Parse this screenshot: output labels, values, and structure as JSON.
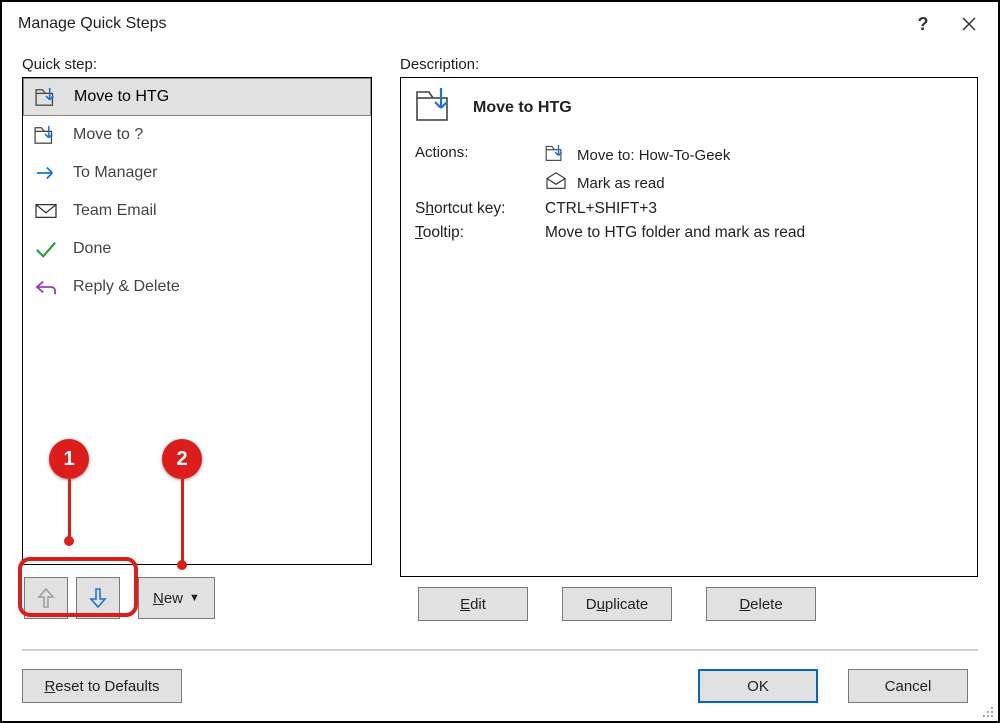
{
  "titlebar": {
    "title": "Manage Quick Steps"
  },
  "left_label": "Quick step:",
  "right_label": "Description:",
  "quick_steps": [
    {
      "label": "Move to HTG",
      "icon": "move-folder"
    },
    {
      "label": "Move to ?",
      "icon": "move-folder"
    },
    {
      "label": "To Manager",
      "icon": "arrow-right"
    },
    {
      "label": "Team Email",
      "icon": "envelope"
    },
    {
      "label": "Done",
      "icon": "check"
    },
    {
      "label": "Reply & Delete",
      "icon": "reply"
    }
  ],
  "selected_index": 0,
  "detail": {
    "name": "Move to HTG",
    "actions_label": "Actions:",
    "actions": [
      {
        "icon": "move-folder",
        "text": "Move to: How-To-Geek"
      },
      {
        "icon": "envelope-open",
        "text": "Mark as read"
      }
    ],
    "shortcut_label_pre": "S",
    "shortcut_label_u": "h",
    "shortcut_label_post": "ortcut key:",
    "shortcut_value": "CTRL+SHIFT+3",
    "tooltip_label_u": "T",
    "tooltip_label_post": "ooltip:",
    "tooltip_value": "Move to HTG folder and mark as read"
  },
  "buttons": {
    "edit_u": "E",
    "edit_post": "dit",
    "duplicate_pre": "D",
    "duplicate_u": "u",
    "duplicate_post": "plicate",
    "delete_u": "D",
    "delete_post": "elete",
    "new_u": "N",
    "new_post": "ew",
    "reset_u": "R",
    "reset_post": "eset to Defaults",
    "ok": "OK",
    "cancel": "Cancel"
  },
  "annotations": {
    "callout1": "1",
    "callout2": "2"
  }
}
